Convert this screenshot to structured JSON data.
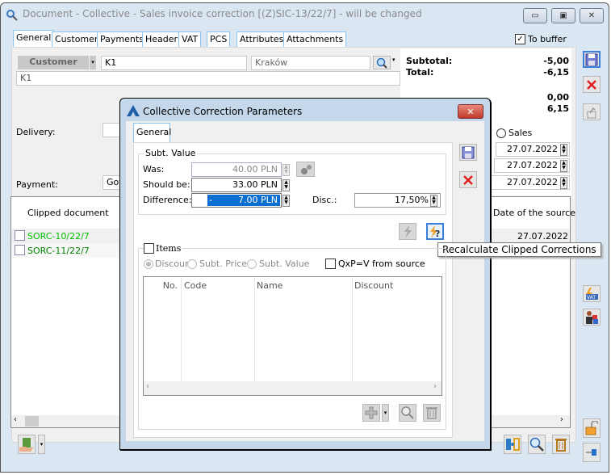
{
  "window": {
    "title": "Document - Collective - Sales invoice correction [(Z)SIC-13/22/7]  - will be changed",
    "tabs": [
      "General",
      "Customer",
      "Payments",
      "Header",
      "VAT",
      "PCS",
      "Attributes",
      "Attachments"
    ],
    "active_tab": "General",
    "to_buffer_label": "To buffer",
    "to_buffer_checked": true
  },
  "customer": {
    "type_label": "Customer",
    "code": "K1",
    "city": "Kraków",
    "name": "K1"
  },
  "totals": {
    "subtotal_label": "Subtotal:",
    "subtotal_value": "-5,00",
    "total_label": "Total:",
    "total_value": "-6,15",
    "value3": "0,00",
    "value4": "6,15"
  },
  "form": {
    "delivery_label": "Delivery:",
    "payment_label": "Payment:",
    "payment_value": "Got",
    "sales_radio_label": "Sales",
    "date1": "27.07.2022",
    "date2": "27.07.2022",
    "date3": "27.07.2022"
  },
  "clipped_table": {
    "headers": [
      "Clipped document",
      "Date of the source"
    ],
    "rows": [
      {
        "document": "SORC-10/22/7",
        "date": "27.07.2022"
      },
      {
        "document": "SORC-11/22/7",
        "date": ""
      }
    ]
  },
  "dialog": {
    "title": "Collective Correction Parameters",
    "tab": "General",
    "group_label": "Subt. Value",
    "was_label": "Was:",
    "was_value": "40.00 PLN",
    "should_be_label": "Should be:",
    "should_be_value": "33.00 PLN",
    "difference_label": "Difference:",
    "difference_sign": "-",
    "difference_value": "7.00 PLN",
    "disc_label": "Disc.:",
    "disc_value": "17,50%",
    "items_label": "Items",
    "radio_discount": "Discoun",
    "radio_subt_price": "Subt. Price",
    "radio_subt_value": "Subt. Value",
    "qxp_label": "QxP=V from source",
    "items_table_headers": [
      "No.",
      "Code",
      "Name",
      "Discount"
    ]
  },
  "tooltip": "Recalculate Clipped Corrections"
}
